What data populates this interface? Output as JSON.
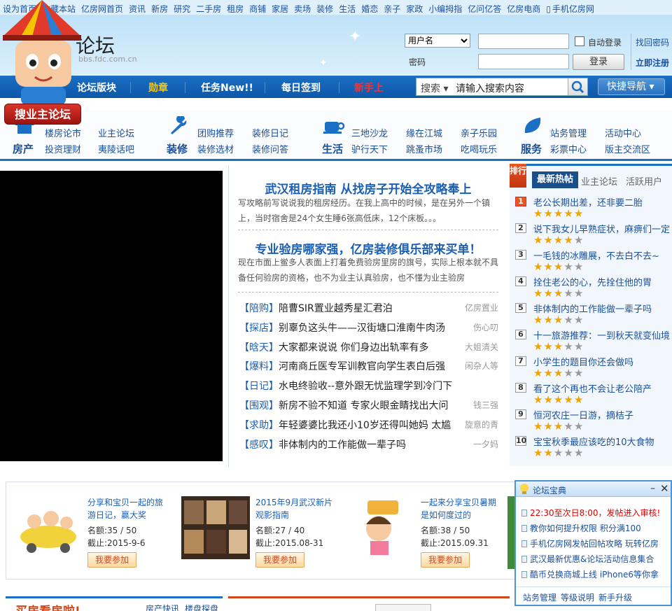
{
  "topbar": {
    "links": [
      "设为首页",
      "收藏本站",
      "亿房网首页",
      "资讯",
      "新房",
      "研究",
      "二手房",
      "租房",
      "商铺",
      "家居",
      "卖场",
      "装修",
      "生活",
      "婚恋",
      "亲子",
      "家政",
      "小编拇指",
      "亿问亿答",
      "亿房电商"
    ],
    "phone": "手机亿房网"
  },
  "header": {
    "title": "论坛",
    "domain": "bbs.fdc.com.cn",
    "badge": "搜业主论坛"
  },
  "login": {
    "select_value": "用户名",
    "password_label": "密码",
    "auto_login": "自动登录",
    "login_button": "登录",
    "forgot": "找回密码",
    "register": "立即注册"
  },
  "nav": {
    "items": [
      "论坛版块",
      "勋章",
      "任务New!!",
      "每日签到",
      "新手上"
    ],
    "search_select": "搜索",
    "search_placeholder": "请输入搜索内容",
    "quick": "快捷导航"
  },
  "categories": [
    {
      "name": "房产",
      "links": [
        "楼房论市",
        "业主论坛",
        "投资理财",
        "夷陵话吧"
      ]
    },
    {
      "name": "装修",
      "links": [
        "团购推荐",
        "装修日记",
        "装修选材",
        "装修问答"
      ]
    },
    {
      "name": "生活",
      "links": [
        "三地沙龙",
        "缘在江城",
        "亲子乐园",
        "驴行天下",
        "跳蚤市场",
        "吃喝玩乐"
      ]
    },
    {
      "name": "服务",
      "links": [
        "站务管理",
        "活动中心",
        "彩票中心",
        "版主交流区"
      ]
    }
  ],
  "headlines": [
    {
      "title": "武汉租房指南 从找房子开始全攻略奉上",
      "summary": "写攻略前写说说我的租房经历。在我上高中的时候，是在另外一个镇上，当时宿舍是24个女生睡6张高低床，12个床板。。。"
    },
    {
      "title": "专业验房哪家强，亿房装修俱乐部来买单！",
      "summary": "现在市面上鲎多人表面上打着免费验房里房的旗号，实际上根本就不具备任何验房的资格，也不为业主认真验房，也不懂为业主验房"
    }
  ],
  "news": [
    {
      "tag": "【陪购】",
      "title": "陪曹SIR置业越秀星汇君泊",
      "author": "亿房置业"
    },
    {
      "tag": "【探店】",
      "title": "别辜负这头牛——汉街塘口淮南牛肉汤",
      "author": "伤心叨"
    },
    {
      "tag": "【晗天】",
      "title": "大家都来说说 你们身边出轨率有多",
      "author": "大姐清关"
    },
    {
      "tag": "【爆料】",
      "title": "河南商丘医专军训教官向学生表白后强",
      "author": "闲杂人等"
    },
    {
      "tag": "【日记】",
      "title": "水电终验收--意外跟无忧监理学到冷门下",
      "author": ""
    },
    {
      "tag": "【围观】",
      "title": "新房不验不知道 专家火眼金睛找出大问",
      "author": "钱三强"
    },
    {
      "tag": "【求助】",
      "title": "年轻婆婆比我还小10岁还得叫她妈 太尴",
      "author": "旋意的青"
    },
    {
      "tag": "【感叹】",
      "title": "非体制内的工作能做一辈子吗",
      "author": "一夕妈"
    }
  ],
  "ranking": {
    "tag": "排行",
    "tabs": [
      "最新热帖",
      "业主论坛",
      "活跃用户"
    ],
    "items": [
      {
        "n": "1",
        "title": "老公长期出差，还非要二胎",
        "stars": 5
      },
      {
        "n": "2",
        "title": "说下我女儿早熟症状，麻痹们一定",
        "stars": 4
      },
      {
        "n": "3",
        "title": "一毛钱的冰雕展，不去白不去~",
        "stars": 3
      },
      {
        "n": "4",
        "title": "拴住老公的心，先拴住他的胃",
        "stars": 3
      },
      {
        "n": "5",
        "title": "非体制内的工作能做一辈子吗",
        "stars": 3
      },
      {
        "n": "6",
        "title": "十一旅游推荐：一到秋天就变仙境",
        "stars": 3
      },
      {
        "n": "7",
        "title": "小学生的题目你还会做吗",
        "stars": 3
      },
      {
        "n": "8",
        "title": "看了这个再也不会让老公陪产",
        "stars": 5
      },
      {
        "n": "9",
        "title": "恒河农庄一日游，摘桔子",
        "stars": 3
      },
      {
        "n": "10",
        "title": "宝宝秋季最应该吃的10大食物",
        "stars": 2
      }
    ]
  },
  "activities": [
    {
      "title": "分享和宝贝一起的旅游日记，赢大奖",
      "quota": "名额:35 / 50",
      "deadline": "截止:2015-9-6",
      "join": "我要参加"
    },
    {
      "title": "2015年9月武汉新片观影指南",
      "quota": "名额:27 / 40",
      "deadline": "截止:2015.08-31",
      "join": "我要参加"
    },
    {
      "title": "一起来分享宝贝暑期是如何度过的",
      "quota": "名额:38 / 50",
      "deadline": "截止:2015.09.31",
      "join": "我要参加"
    }
  ],
  "popup": {
    "title": "论坛宝典",
    "items": [
      {
        "text": "22:30至次日8:00，发帖进入审核!",
        "red": true
      },
      {
        "text": "教你如何提升权限 积分满100",
        "red": false
      },
      {
        "text": "手机亿房网发帖回帖攻略 玩转亿房",
        "red": false
      },
      {
        "text": "武汉最新优惠&论坛活动信息集合",
        "red": false
      },
      {
        "text": "酷币兑换商城上线 iPhone6等你拿",
        "red": false
      }
    ],
    "footer": [
      "站务管理",
      "等级说明",
      "新手升级"
    ]
  },
  "bottom": {
    "left_title": "买房看房啦!",
    "left_tabs": [
      "房产快讯",
      "楼盘探盘"
    ]
  },
  "colors": {
    "primary": "#1b6fc4",
    "accent": "#d2461a",
    "link": "#1a4f9c"
  }
}
